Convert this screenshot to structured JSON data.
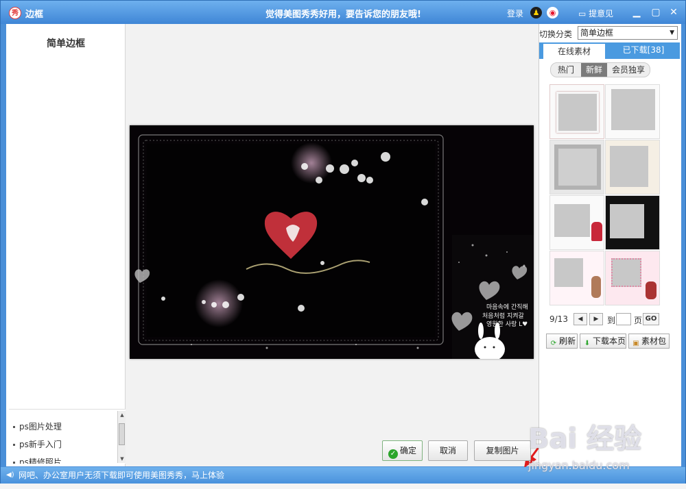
{
  "window": {
    "title": "边框",
    "promo": "觉得美图秀秀好用，要告诉您的朋友哦!",
    "login": "登录",
    "feedback": "提意见"
  },
  "left_panel": {
    "title": "简单边框",
    "tutorials": [
      "ps图片处理",
      "ps新手入门",
      "ps精修照片"
    ]
  },
  "preview": {
    "overlay_text_line1": "마음속에 간직해",
    "overlay_text_line2": "처음처럼 지켜갈",
    "overlay_text_line3": "영원한 사랑 L♥"
  },
  "actions": {
    "ok": "确定",
    "cancel": "取消",
    "copy": "复制图片"
  },
  "right_panel": {
    "category_label": "切换分类",
    "category_value": "简单边框",
    "tabs": [
      "在线素材",
      "已下载[38]"
    ],
    "subtabs": [
      "热门",
      "新鲜",
      "会员独享"
    ],
    "active_subtab": "新鲜",
    "pager": {
      "current": "9/13",
      "to_label": "到",
      "page_label": "页",
      "go": "GO"
    },
    "buttons": {
      "refresh": "刷新",
      "download_page": "下载本页",
      "package": "素材包"
    }
  },
  "statusbar": {
    "text": "网吧、办公室用户无须下载即可使用美图秀秀，马上体验"
  },
  "watermark": {
    "main": "Bai 经验",
    "sub": "jingyan.baidu.com"
  },
  "colors": {
    "titlebar": "#4a8fd8",
    "accent": "#4a9ae0",
    "ok_green": "#2ca52c",
    "arrow_red": "#e01b1b"
  }
}
